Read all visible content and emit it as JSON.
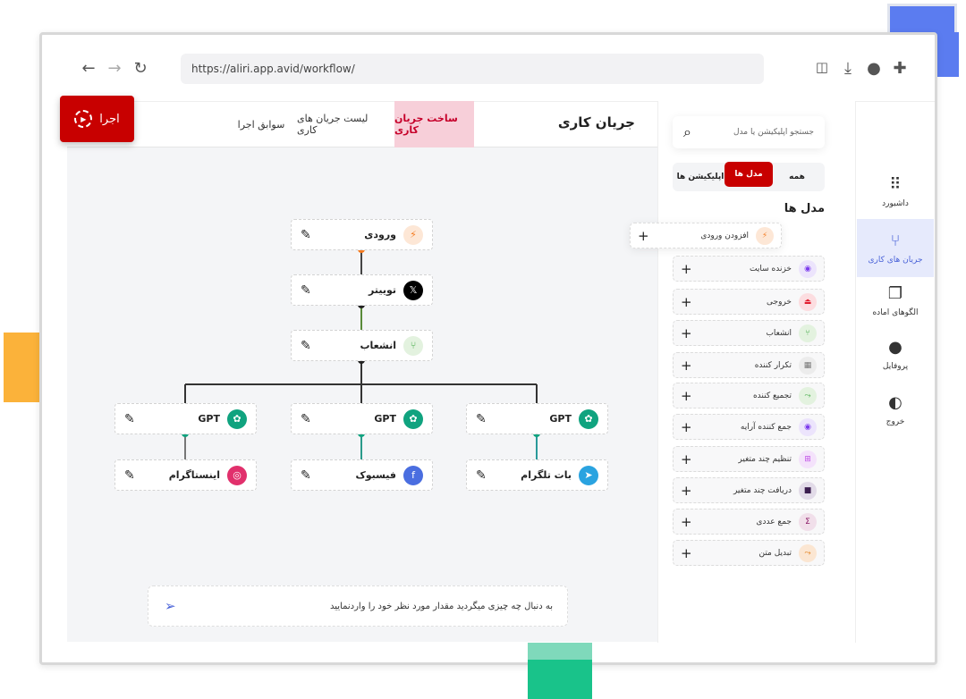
{
  "browser": {
    "url": "https://aliri.app.avid/workflow/",
    "icons": [
      "back-arrow-icon",
      "forward-arrow-icon",
      "reload-icon",
      "pocket-icon",
      "download-icon",
      "account-icon",
      "extensions-icon"
    ]
  },
  "header": {
    "title": "جریان کاری",
    "tabs": [
      {
        "label": "ساخت جریان کاری",
        "active": true
      },
      {
        "label": "لیست جریان های کاری"
      },
      {
        "label": "سوابق اجرا"
      }
    ],
    "run_label": "اجرا"
  },
  "nodes": [
    {
      "label": "ورودی",
      "icon": "lightning-icon",
      "color": "#f47b20",
      "bg": "#fde7d6"
    },
    {
      "label": "تویيتر",
      "icon": "x-logo-icon",
      "color": "#fff",
      "bg": "#000"
    },
    {
      "label": "انشعاب",
      "icon": "branch-icon",
      "color": "#4caf50",
      "bg": "#e3f2df"
    },
    {
      "label": "GPT",
      "icon": "openai-icon",
      "color": "#fff",
      "bg": "#10a37f"
    },
    {
      "label": "GPT",
      "icon": "openai-icon",
      "color": "#fff",
      "bg": "#10a37f"
    },
    {
      "label": "GPT",
      "icon": "openai-icon",
      "color": "#fff",
      "bg": "#10a37f"
    },
    {
      "label": "اینستاگرام",
      "icon": "instagram-icon",
      "color": "#fff",
      "bg": "#e1306c"
    },
    {
      "label": "فیسبوک",
      "icon": "facebook-icon",
      "color": "#fff",
      "bg": "#4a6ee0"
    },
    {
      "label": "بات تلگرام",
      "icon": "telegram-icon",
      "color": "#fff",
      "bg": "#2aa3e0"
    }
  ],
  "prompt": {
    "placeholder": "به دنبال چه چیزی میگردید  مقدار مورد نظر خود را واردنمایید"
  },
  "panel": {
    "search_placeholder": "جستجو اپلیکیشن یا مدل",
    "filters": [
      {
        "label": "همه"
      },
      {
        "label": "مدل ها",
        "active": true
      },
      {
        "label": "اپلیکیشن ها"
      }
    ],
    "section_title": "مدل ها",
    "add_input": "افزودن ورودی",
    "items": [
      {
        "label": "خزنده سایت",
        "icon": "globe-icon",
        "color": "#7c3aed",
        "bg": "#ece4fc"
      },
      {
        "label": "خروجی",
        "icon": "output-icon",
        "color": "#e11d2e",
        "bg": "#fcdde0"
      },
      {
        "label": "انشعاب",
        "icon": "branch-icon",
        "color": "#4caf50",
        "bg": "#e3f2df"
      },
      {
        "label": "تکرار کننده",
        "icon": "repeat-icon",
        "color": "#777",
        "bg": "#ececec"
      },
      {
        "label": "تجمیع کننده",
        "icon": "aggregate-icon",
        "color": "#4caf50",
        "bg": "#e3f2df"
      },
      {
        "label": "جمع کننده آرایه",
        "icon": "globe-icon",
        "color": "#7c3aed",
        "bg": "#ece4fc"
      },
      {
        "label": "تنظیم چند متغیر",
        "icon": "set-variables-icon",
        "color": "#c04ee6",
        "bg": "#f4e2fb"
      },
      {
        "label": "دریافت چند متغیر",
        "icon": "get-variables-icon",
        "color": "#3b1d4f",
        "bg": "#e2dbe8"
      },
      {
        "label": "جمع عددی",
        "icon": "sum-icon",
        "color": "#8a1a66",
        "bg": "#f1dfea"
      },
      {
        "label": "تبدیل متن",
        "icon": "text-convert-icon",
        "color": "#e07a10",
        "bg": "#fbe6d2"
      }
    ]
  },
  "sidebar": {
    "items": [
      {
        "label": "داشبورد",
        "icon": "dashboard-icon"
      },
      {
        "label": "جریان های کاری",
        "icon": "workflow-icon",
        "active": true
      },
      {
        "label": "الگوهای اماده",
        "icon": "templates-icon"
      },
      {
        "label": "پروفایل",
        "icon": "profile-icon"
      },
      {
        "label": "خروج",
        "icon": "logout-icon"
      }
    ]
  }
}
